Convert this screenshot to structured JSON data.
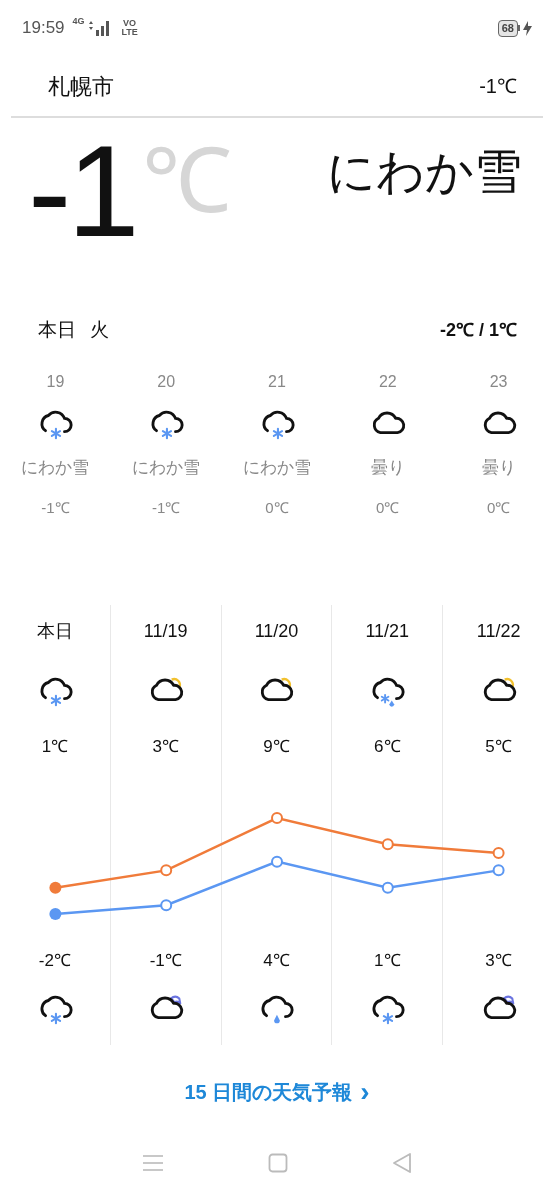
{
  "status_bar": {
    "time": "19:59",
    "network": "4G",
    "volte": "VO LTE",
    "battery": "68",
    "charging": true
  },
  "header": {
    "city": "札幌市",
    "temperature": "-1℃"
  },
  "current": {
    "temperature": "-1",
    "unit": "℃",
    "condition": "にわか雪"
  },
  "today": {
    "label": "本日",
    "weekday": "火",
    "range": "-2℃ / 1℃"
  },
  "hourly": [
    {
      "time": "19",
      "kind": "snow",
      "condition": "にわか雪",
      "temperature": "-1℃"
    },
    {
      "time": "20",
      "kind": "snow",
      "condition": "にわか雪",
      "temperature": "-1℃"
    },
    {
      "time": "21",
      "kind": "snow",
      "condition": "にわか雪",
      "temperature": "0℃"
    },
    {
      "time": "22",
      "kind": "cloudy",
      "condition": "曇り",
      "temperature": "0℃"
    },
    {
      "time": "23",
      "kind": "cloudy",
      "condition": "曇り",
      "temperature": "0℃"
    }
  ],
  "daily": {
    "days": [
      {
        "date": "本日",
        "day_icon": {
          "kind": "snow"
        },
        "high": "1℃",
        "low": "-2℃",
        "night_icon": {
          "kind": "snow"
        }
      },
      {
        "date": "11/19",
        "day_icon": {
          "kind": "partly_sunny"
        },
        "high": "3℃",
        "low": "-1℃",
        "night_icon": {
          "kind": "night_cloudy"
        }
      },
      {
        "date": "11/20",
        "day_icon": {
          "kind": "partly_sunny"
        },
        "high": "9℃",
        "low": "4℃",
        "night_icon": {
          "kind": "rain"
        }
      },
      {
        "date": "11/21",
        "day_icon": {
          "kind": "sleet"
        },
        "high": "6℃",
        "low": "1℃",
        "night_icon": {
          "kind": "snow"
        }
      },
      {
        "date": "11/22",
        "day_icon": {
          "kind": "partly_sunny"
        },
        "high": "5℃",
        "low": "3℃",
        "night_icon": {
          "kind": "night_cloudy"
        }
      }
    ]
  },
  "forecast_link": {
    "label": "15 日間の天気予報",
    "arrow": "›"
  }
}
